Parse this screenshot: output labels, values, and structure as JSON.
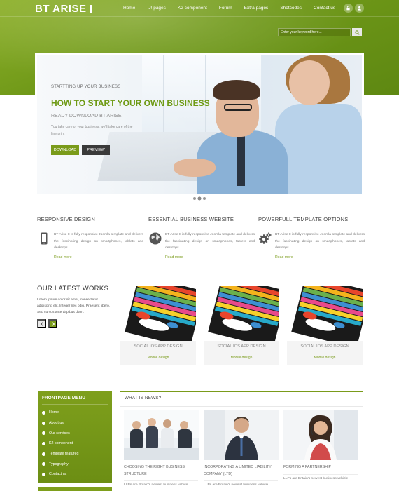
{
  "header": {
    "logo": "BT ARISE",
    "nav": [
      "Home",
      "J! pages",
      "K2 component",
      "Forum",
      "Extra pages",
      "Shotcodes",
      "Contact us"
    ],
    "icons": [
      "lock-icon",
      "user-icon"
    ],
    "search_placeholder": "Enter your keyword here..."
  },
  "slider": {
    "tag": "STARTTING UP YOUR BUSINESS",
    "title": "HOW TO START YOUR OWN BUSINESS",
    "subtitle": "READY DOWNLOAD BT ARISE",
    "description": "You take care of your business, we'll take care of the fine print",
    "download_label": "DOWNLOAD",
    "preview_label": "PREVIEW",
    "dots": 3,
    "active_dot": 2
  },
  "features": [
    {
      "title": "RESPONSIVE DESIGN",
      "icon": "smartphone-icon",
      "text": "BT Arise II is fully responsive Joomla template and delivers the fascinating design on smartphones, tablets and desktops.",
      "more": "Read more"
    },
    {
      "title": "ESSENTIAL BUSINESS WEBSITE",
      "icon": "globe-icon",
      "text": "BT Arise II is fully responsive Joomla template and delivers the fascinating design on smartphones, tablets and desktops.",
      "more": "Read more"
    },
    {
      "title": "POWERFULL TEMPLATE OPTIONS",
      "icon": "gears-icon",
      "text": "BT Arise II is fully responsive Joomla template and delivers the fascinating design on smartphones, tablets and desktops.",
      "more": "Read more"
    }
  ],
  "works": {
    "title": "OUR LATEST WORKS",
    "description": "Lorem ipsum dolor sit amet, consectetur adipiscing elit. Integer nec odio. Praesent libero. Sed cursus ante dapibus diam.",
    "items": [
      {
        "name": "SOCIAL IOS APP DESIGN",
        "category": "Mobile design"
      },
      {
        "name": "SOCIAL IOS APP DESIGN",
        "category": "Mobile design"
      },
      {
        "name": "SOCIAL IOS APP DESIGN",
        "category": "Mobile design"
      }
    ]
  },
  "frontpage_menu": {
    "title": "FRONTPAGE MENU",
    "items": [
      "Home",
      "About us",
      "Our services",
      "K2 component",
      "Template featured",
      "Typography",
      "Contact us"
    ]
  },
  "news": {
    "title": "WHAT IS NEWS?",
    "items": [
      {
        "title": "CHOOSING THE RIGHT BUSINESS STRUCTURE",
        "excerpt": "LLPs are Britain's newest business vehicle"
      },
      {
        "title": "INCORPORATING A LIMITED LIABILITY COMPANY (LTD)",
        "excerpt": "LLPs are Britain's newest business vehicle"
      },
      {
        "title": "FORMING A PARTNERSHIP",
        "excerpt": "LLPs are Britain's newest business vehicle"
      }
    ]
  },
  "colors": {
    "brand_green": "#7a9b1a",
    "header_green": "#6f9818",
    "dark_button": "#3a3a3a"
  }
}
